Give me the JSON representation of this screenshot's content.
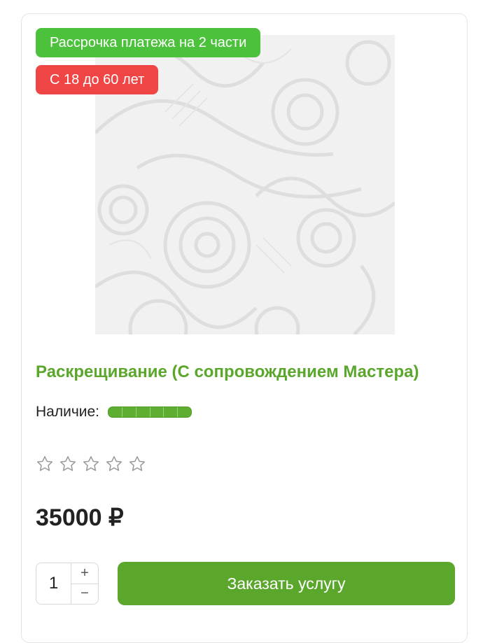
{
  "product": {
    "badges": {
      "installment": "Рассрочка платежа на 2 части",
      "age": "С 18 до 60 лет"
    },
    "image_icon": "paisley-pattern-image",
    "title": "Раскрещивание (С сопровождением Мастера)",
    "availability_label": "Наличие:",
    "stock_level_segments_filled": 6,
    "stock_level_segments_total": 6,
    "rating": {
      "filled": 0,
      "max": 5,
      "icon": "star-outline-icon"
    },
    "price": "35000 ₽"
  },
  "cart": {
    "quantity": "1",
    "increment_label": "+",
    "decrement_label": "−",
    "order_button_label": "Заказать услугу"
  },
  "colors": {
    "accent_green": "#5aa72c",
    "installment_badge": "#4cc23c",
    "age_badge": "#f04545"
  }
}
